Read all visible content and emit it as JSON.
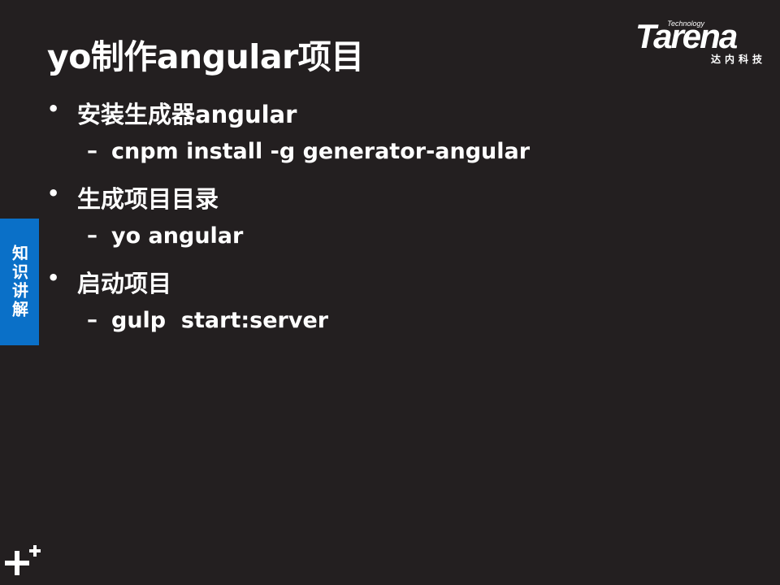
{
  "slide": {
    "title": "yo制作angular项目",
    "bullets": [
      {
        "text": "安装生成器angular",
        "sub": [
          "cnpm install -g generator-angular"
        ]
      },
      {
        "text": "生成项目目录",
        "sub": [
          "yo angular"
        ]
      },
      {
        "text": "启动项目",
        "sub": [
          "gulp  start:server"
        ]
      }
    ],
    "bullet_symbol": "•",
    "sub_symbol": "–"
  },
  "logo": {
    "word": "Tarena",
    "tagline": "Technology",
    "chinese": "达内科技"
  },
  "side_tab": {
    "label": "知识讲解",
    "color": "#0a70c8"
  },
  "colors": {
    "background": "#231f20",
    "text": "#ffffff"
  },
  "icons": {
    "corner": "plus-plus-icon"
  }
}
